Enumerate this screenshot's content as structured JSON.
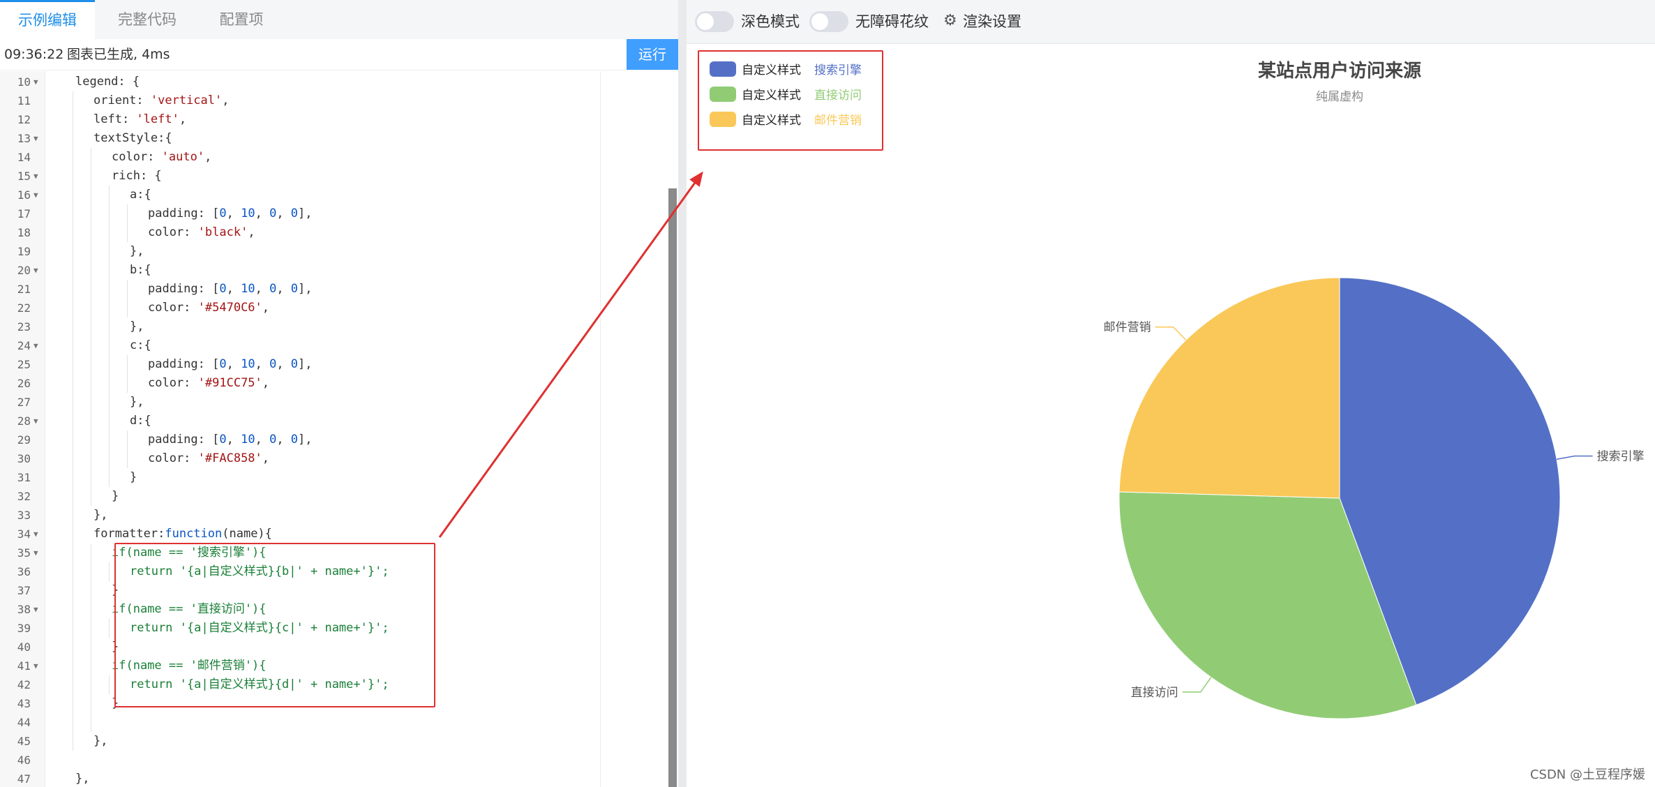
{
  "editor_panel": {
    "tabs": [
      {
        "label": "示例编辑",
        "active": true
      },
      {
        "label": "完整代码",
        "active": false
      },
      {
        "label": "配置项",
        "active": false
      }
    ],
    "status_time": "09:36:22",
    "status_message": "图表已生成, 4ms",
    "run_label": "运行",
    "code_lines": [
      {
        "n": "10",
        "fold": true,
        "indent": 1,
        "text": "legend: {"
      },
      {
        "n": "11",
        "fold": false,
        "indent": 2,
        "text": "orient: 'vertical',"
      },
      {
        "n": "12",
        "fold": false,
        "indent": 2,
        "text": "left: 'left',"
      },
      {
        "n": "13",
        "fold": true,
        "indent": 2,
        "text": "textStyle:{"
      },
      {
        "n": "14",
        "fold": false,
        "indent": 3,
        "text": "color: 'auto',"
      },
      {
        "n": "15",
        "fold": true,
        "indent": 3,
        "text": "rich: {"
      },
      {
        "n": "16",
        "fold": true,
        "indent": 4,
        "text": "a:{"
      },
      {
        "n": "17",
        "fold": false,
        "indent": 5,
        "text": "padding: [0, 10, 0, 0],"
      },
      {
        "n": "18",
        "fold": false,
        "indent": 5,
        "text": "color: 'black',"
      },
      {
        "n": "19",
        "fold": false,
        "indent": 4,
        "text": "},"
      },
      {
        "n": "20",
        "fold": true,
        "indent": 4,
        "text": "b:{"
      },
      {
        "n": "21",
        "fold": false,
        "indent": 5,
        "text": "padding: [0, 10, 0, 0],"
      },
      {
        "n": "22",
        "fold": false,
        "indent": 5,
        "text": "color: '#5470C6',"
      },
      {
        "n": "23",
        "fold": false,
        "indent": 4,
        "text": "},"
      },
      {
        "n": "24",
        "fold": true,
        "indent": 4,
        "text": "c:{"
      },
      {
        "n": "25",
        "fold": false,
        "indent": 5,
        "text": "padding: [0, 10, 0, 0],"
      },
      {
        "n": "26",
        "fold": false,
        "indent": 5,
        "text": "color: '#91CC75',"
      },
      {
        "n": "27",
        "fold": false,
        "indent": 4,
        "text": "},"
      },
      {
        "n": "28",
        "fold": true,
        "indent": 4,
        "text": "d:{"
      },
      {
        "n": "29",
        "fold": false,
        "indent": 5,
        "text": "padding: [0, 10, 0, 0],"
      },
      {
        "n": "30",
        "fold": false,
        "indent": 5,
        "text": "color: '#FAC858',"
      },
      {
        "n": "31",
        "fold": false,
        "indent": 4,
        "text": "}"
      },
      {
        "n": "32",
        "fold": false,
        "indent": 3,
        "text": "}"
      },
      {
        "n": "33",
        "fold": false,
        "indent": 2,
        "text": "},"
      },
      {
        "n": "34",
        "fold": true,
        "indent": 2,
        "text": "formatter:function(name){"
      },
      {
        "n": "35",
        "fold": true,
        "indent": 3,
        "text": "if(name == '搜索引擎'){"
      },
      {
        "n": "36",
        "fold": false,
        "indent": 4,
        "text": "return '{a|自定义样式}{b|' + name+'}';"
      },
      {
        "n": "37",
        "fold": false,
        "indent": 3,
        "text": "}"
      },
      {
        "n": "38",
        "fold": true,
        "indent": 3,
        "text": "if(name == '直接访问'){"
      },
      {
        "n": "39",
        "fold": false,
        "indent": 4,
        "text": "return '{a|自定义样式}{c|' + name+'}';"
      },
      {
        "n": "40",
        "fold": false,
        "indent": 3,
        "text": "}"
      },
      {
        "n": "41",
        "fold": true,
        "indent": 3,
        "text": "if(name == '邮件营销'){"
      },
      {
        "n": "42",
        "fold": false,
        "indent": 4,
        "text": "return '{a|自定义样式}{d|' + name+'}';"
      },
      {
        "n": "43",
        "fold": false,
        "indent": 3,
        "text": "}"
      },
      {
        "n": "44",
        "fold": false,
        "indent": 3,
        "text": ""
      },
      {
        "n": "45",
        "fold": false,
        "indent": 2,
        "text": "},"
      },
      {
        "n": "46",
        "fold": false,
        "indent": 1,
        "text": ""
      },
      {
        "n": "47",
        "fold": false,
        "indent": 1,
        "text": "},"
      }
    ]
  },
  "preview_panel": {
    "toolbar": {
      "dark_mode_label": "深色模式",
      "aria_label": "无障碍花纹",
      "render_settings_label": "渲染设置"
    },
    "footer": "CSDN @土豆程序媛"
  },
  "chart_data": {
    "type": "pie",
    "title": "某站点用户访问来源",
    "subtitle": "纯属虚构",
    "legend": {
      "placement": "top-left",
      "orient": "vertical",
      "prefix": "自定义样式",
      "items": [
        "搜索引擎",
        "直接访问",
        "邮件营销"
      ]
    },
    "slices": [
      {
        "name": "搜索引擎",
        "value": 1048,
        "color": "#5470c6"
      },
      {
        "name": "直接访问",
        "value": 735,
        "color": "#91cc75"
      },
      {
        "name": "邮件营销",
        "value": 580,
        "color": "#fac858"
      }
    ]
  }
}
